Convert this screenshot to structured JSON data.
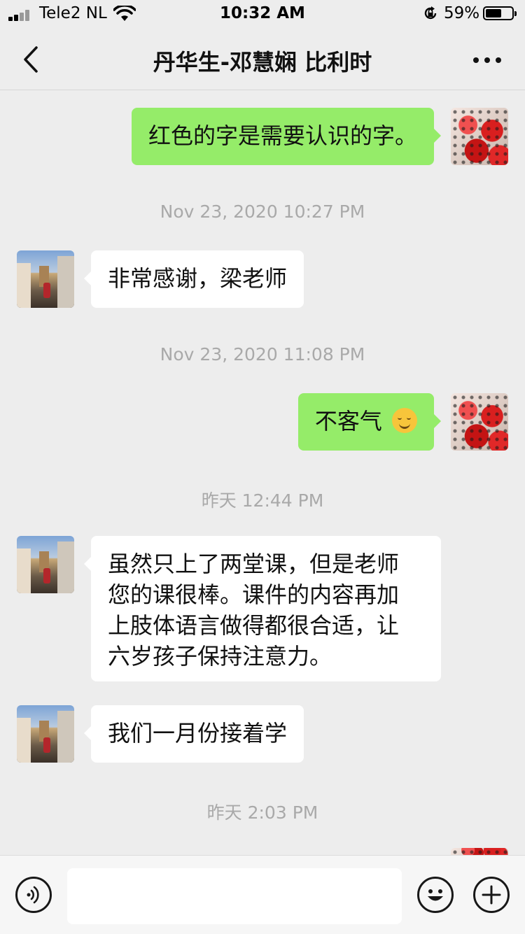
{
  "status_bar": {
    "carrier": "Tele2 NL",
    "time": "10:32 AM",
    "battery_percent": "59%",
    "battery_level": 0.59,
    "signal_bars": 2
  },
  "header": {
    "title": "丹华生-邓慧娴 比利时"
  },
  "messages": [
    {
      "type": "message",
      "side": "out",
      "text": "红色的字是需要认识的字。"
    },
    {
      "type": "timestamp",
      "text": "Nov 23, 2020 10:27 PM"
    },
    {
      "type": "message",
      "side": "in",
      "text": "非常感谢，梁老师"
    },
    {
      "type": "timestamp",
      "text": "Nov 23, 2020 11:08 PM"
    },
    {
      "type": "message",
      "side": "out",
      "text": "不客气",
      "emoji": "smiling-face"
    },
    {
      "type": "timestamp",
      "text": "昨天 12:44 PM"
    },
    {
      "type": "message",
      "side": "in",
      "lines": [
        "虽然只上了两堂课，但是老师",
        "您的课很棒。课件的内容再加",
        "上肢体语言做得都很合适，让",
        "六岁孩子保持注意力。"
      ]
    },
    {
      "type": "message",
      "side": "in",
      "text": "我们一月份接着学"
    },
    {
      "type": "timestamp",
      "text": "昨天 2:03 PM"
    }
  ],
  "input": {
    "value": "",
    "placeholder": ""
  },
  "icons": {
    "back": "chevron-left-icon",
    "more": "more-dots-icon",
    "voice": "voice-icon",
    "emoji": "emoji-icon",
    "plus": "plus-icon"
  },
  "colors": {
    "outgoing_bubble": "#95ec69",
    "incoming_bubble": "#ffffff",
    "background": "#ededed",
    "timestamp": "#a9a9a9"
  }
}
